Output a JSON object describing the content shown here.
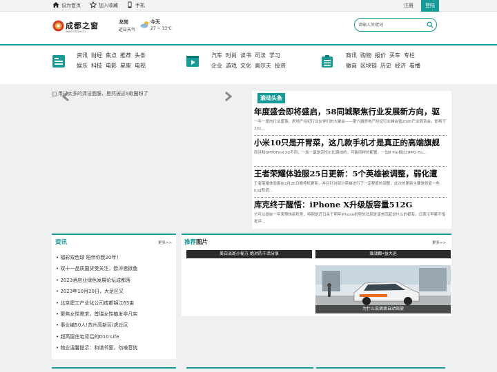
{
  "topbar": {
    "home": "设为首页",
    "favorite": "加入收藏",
    "mobile": "手机",
    "register": "注册",
    "login": "登陆"
  },
  "header": {
    "logo_text": "成都之窗",
    "logo_sub": "www.cdycw.cn",
    "weather_city": "龙岗",
    "weather_state": "近日天气",
    "weather_day": "今天",
    "weather_temp": "27 ~ 33℃",
    "search_placeholder": "请输入关键词"
  },
  "nav": {
    "group1_row1": [
      "资讯",
      "财经",
      "焦点",
      "推荐",
      "头条"
    ],
    "group1_row2": [
      "娱乐",
      "科技",
      "电影",
      "星座",
      "电视"
    ],
    "group2_row1": [
      "汽车",
      "时尚",
      "读书",
      "司法",
      "学习"
    ],
    "group2_row2": [
      "企业",
      "游戏",
      "文化",
      "高尔夫",
      "投资"
    ],
    "group3_row1": [
      "商讯",
      "购物",
      "报价",
      "买车",
      "专栏"
    ],
    "group3_row2": [
      "徽商",
      "区块链",
      "历史",
      "经济",
      "看播"
    ]
  },
  "slider": {
    "caption": "用过太多的清洁面膜，居然被这9款圈粉了"
  },
  "headlines": {
    "tag": "滚动头条",
    "items": [
      {
        "title": "年度盛会即将盛启，58同城聚焦行业发展新方向，驱",
        "desc": "一年一度的行业盛事，房地产经纪行业伙伴们的大聚会——第六届房地产经纪行业峰会暨2020产业情资会，即将于202..."
      },
      {
        "title": "小米10只是开胃菜，这几款手机才是真正的高端旗舰",
        "desc": "而且和OPPOFind X2不同，一加一最是走性价比路线的，可能同样的配置，一加8 Pro相比OPPO Fin..."
      },
      {
        "title": "王者荣耀体验服25日更新：5个英雄被调整，弱化遭",
        "desc": "王者荣耀体验服在2月25日晚停机更新，并且针对部分英雄进行了一定程度的调整，此次的更新主要是修复一些bug和调..."
      },
      {
        "title": "库克终于醒悟：iPhone X升级版容量512G",
        "desc": "它可以提前一年来预热新机型，特别是近日关于明年iPhone机型的消息是谣言四起说什么的都有。日表示苹果不惜批评..."
      }
    ]
  },
  "info": {
    "title": "资讯",
    "more": "更多>>",
    "items": [
      "福彩双色球 陪伴你我20年！",
      "双十一品质国货受关注，欧淬思掀鱼",
      "2023酒店业绿色发展论坛成都落",
      "2023年10月20日，大足区又",
      "北京建工产业化公司成都锦江65亩",
      "聚焦女性需求，首瑞女性植发非凡实",
      "事业编50人!苏州高新区(虎丘区",
      "超高层住宅背后的D10 Life",
      "物业温馨提示：和谐邻里，勿噪音扰"
    ]
  },
  "pics": {
    "title_prefix": "推荐",
    "title_suffix": "图片",
    "more": "更多>>",
    "items": [
      "美白淡斑小秘方 绝对的千活分享",
      "爱战都•益大运",
      "为什么说滴滴自动驾驶"
    ]
  },
  "colors": {
    "accent": "#159b98"
  }
}
